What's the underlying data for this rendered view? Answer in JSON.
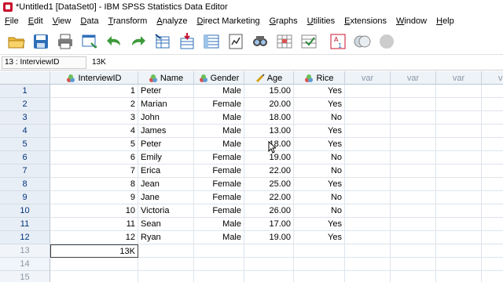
{
  "window": {
    "title": "*Untitled1 [DataSet0] - IBM SPSS Statistics Data Editor"
  },
  "menu": [
    {
      "key": "F",
      "rest": "ile"
    },
    {
      "key": "E",
      "rest": "dit"
    },
    {
      "key": "V",
      "rest": "iew"
    },
    {
      "key": "D",
      "rest": "ata"
    },
    {
      "key": "T",
      "rest": "ransform"
    },
    {
      "key": "A",
      "rest": "nalyze"
    },
    {
      "key": "",
      "rest": "Direct Marketing",
      "full": "Direct Marketing"
    },
    {
      "key": "G",
      "rest": "raphs"
    },
    {
      "key": "U",
      "rest": "tilities"
    },
    {
      "key": "",
      "rest": "Extensions",
      "full": "Extensions"
    },
    {
      "key": "W",
      "rest": "indow"
    },
    {
      "key": "H",
      "rest": "elp"
    }
  ],
  "toolbar": {
    "buttons": [
      "open-folder-icon",
      "save-icon",
      "print-icon",
      "dialog-recall-icon",
      "undo-icon",
      "redo-icon",
      "goto-case-icon",
      "goto-variable-icon",
      "variables-icon",
      "run-descriptives-icon",
      "find-icon",
      "insert-cases-icon",
      "insert-variable-icon",
      "split-file-icon",
      "weight-cases-icon",
      "select-cases-icon",
      "value-labels-icon",
      "use-variable-sets-icon"
    ]
  },
  "cellbar": {
    "ref": "13 : InterviewID",
    "value": "13K"
  },
  "columns": [
    {
      "name": "InterviewID",
      "icon": "nominal",
      "width": 112
    },
    {
      "name": "Name",
      "icon": "nominal",
      "width": 71
    },
    {
      "name": "Gender",
      "icon": "nominal",
      "width": 64
    },
    {
      "name": "Age",
      "icon": "scale",
      "width": 63
    },
    {
      "name": "Rice",
      "icon": "nominal",
      "width": 65
    }
  ],
  "var_columns": [
    "var",
    "var",
    "var",
    "var",
    "var"
  ],
  "rows": [
    {
      "n": "1",
      "id": "1",
      "name": "Peter",
      "gender": "Male",
      "age": "15.00",
      "rice": "Yes"
    },
    {
      "n": "2",
      "id": "2",
      "name": "Marian",
      "gender": "Female",
      "age": "20.00",
      "rice": "Yes"
    },
    {
      "n": "3",
      "id": "3",
      "name": "John",
      "gender": "Male",
      "age": "18.00",
      "rice": "No"
    },
    {
      "n": "4",
      "id": "4",
      "name": "James",
      "gender": "Male",
      "age": "13.00",
      "rice": "Yes"
    },
    {
      "n": "5",
      "id": "5",
      "name": "Peter",
      "gender": "Male",
      "age": "18.00",
      "rice": "Yes"
    },
    {
      "n": "6",
      "id": "6",
      "name": "Emily",
      "gender": "Female",
      "age": "19.00",
      "rice": "No"
    },
    {
      "n": "7",
      "id": "7",
      "name": "Erica",
      "gender": "Female",
      "age": "22.00",
      "rice": "No"
    },
    {
      "n": "8",
      "id": "8",
      "name": "Jean",
      "gender": "Female",
      "age": "25.00",
      "rice": "Yes"
    },
    {
      "n": "9",
      "id": "9",
      "name": "Jane",
      "gender": "Female",
      "age": "22.00",
      "rice": "No"
    },
    {
      "n": "10",
      "id": "10",
      "name": "Victoria",
      "gender": "Female",
      "age": "26.00",
      "rice": "No"
    },
    {
      "n": "11",
      "id": "11",
      "name": "Sean",
      "gender": "Male",
      "age": "17.00",
      "rice": "Yes"
    },
    {
      "n": "12",
      "id": "12",
      "name": "Ryan",
      "gender": "Male",
      "age": "19.00",
      "rice": "Yes"
    },
    {
      "n": "13",
      "id": "13K",
      "name": "",
      "gender": "",
      "age": "",
      "rice": "",
      "editing": true
    },
    {
      "n": "14",
      "id": "",
      "name": "",
      "gender": "",
      "age": "",
      "rice": ""
    },
    {
      "n": "15",
      "id": "",
      "name": "",
      "gender": "",
      "age": "",
      "rice": ""
    }
  ],
  "colors": {
    "header_bg": "#eef3f8",
    "rownum_text": "#00337a",
    "var_text": "#8a97a5"
  }
}
